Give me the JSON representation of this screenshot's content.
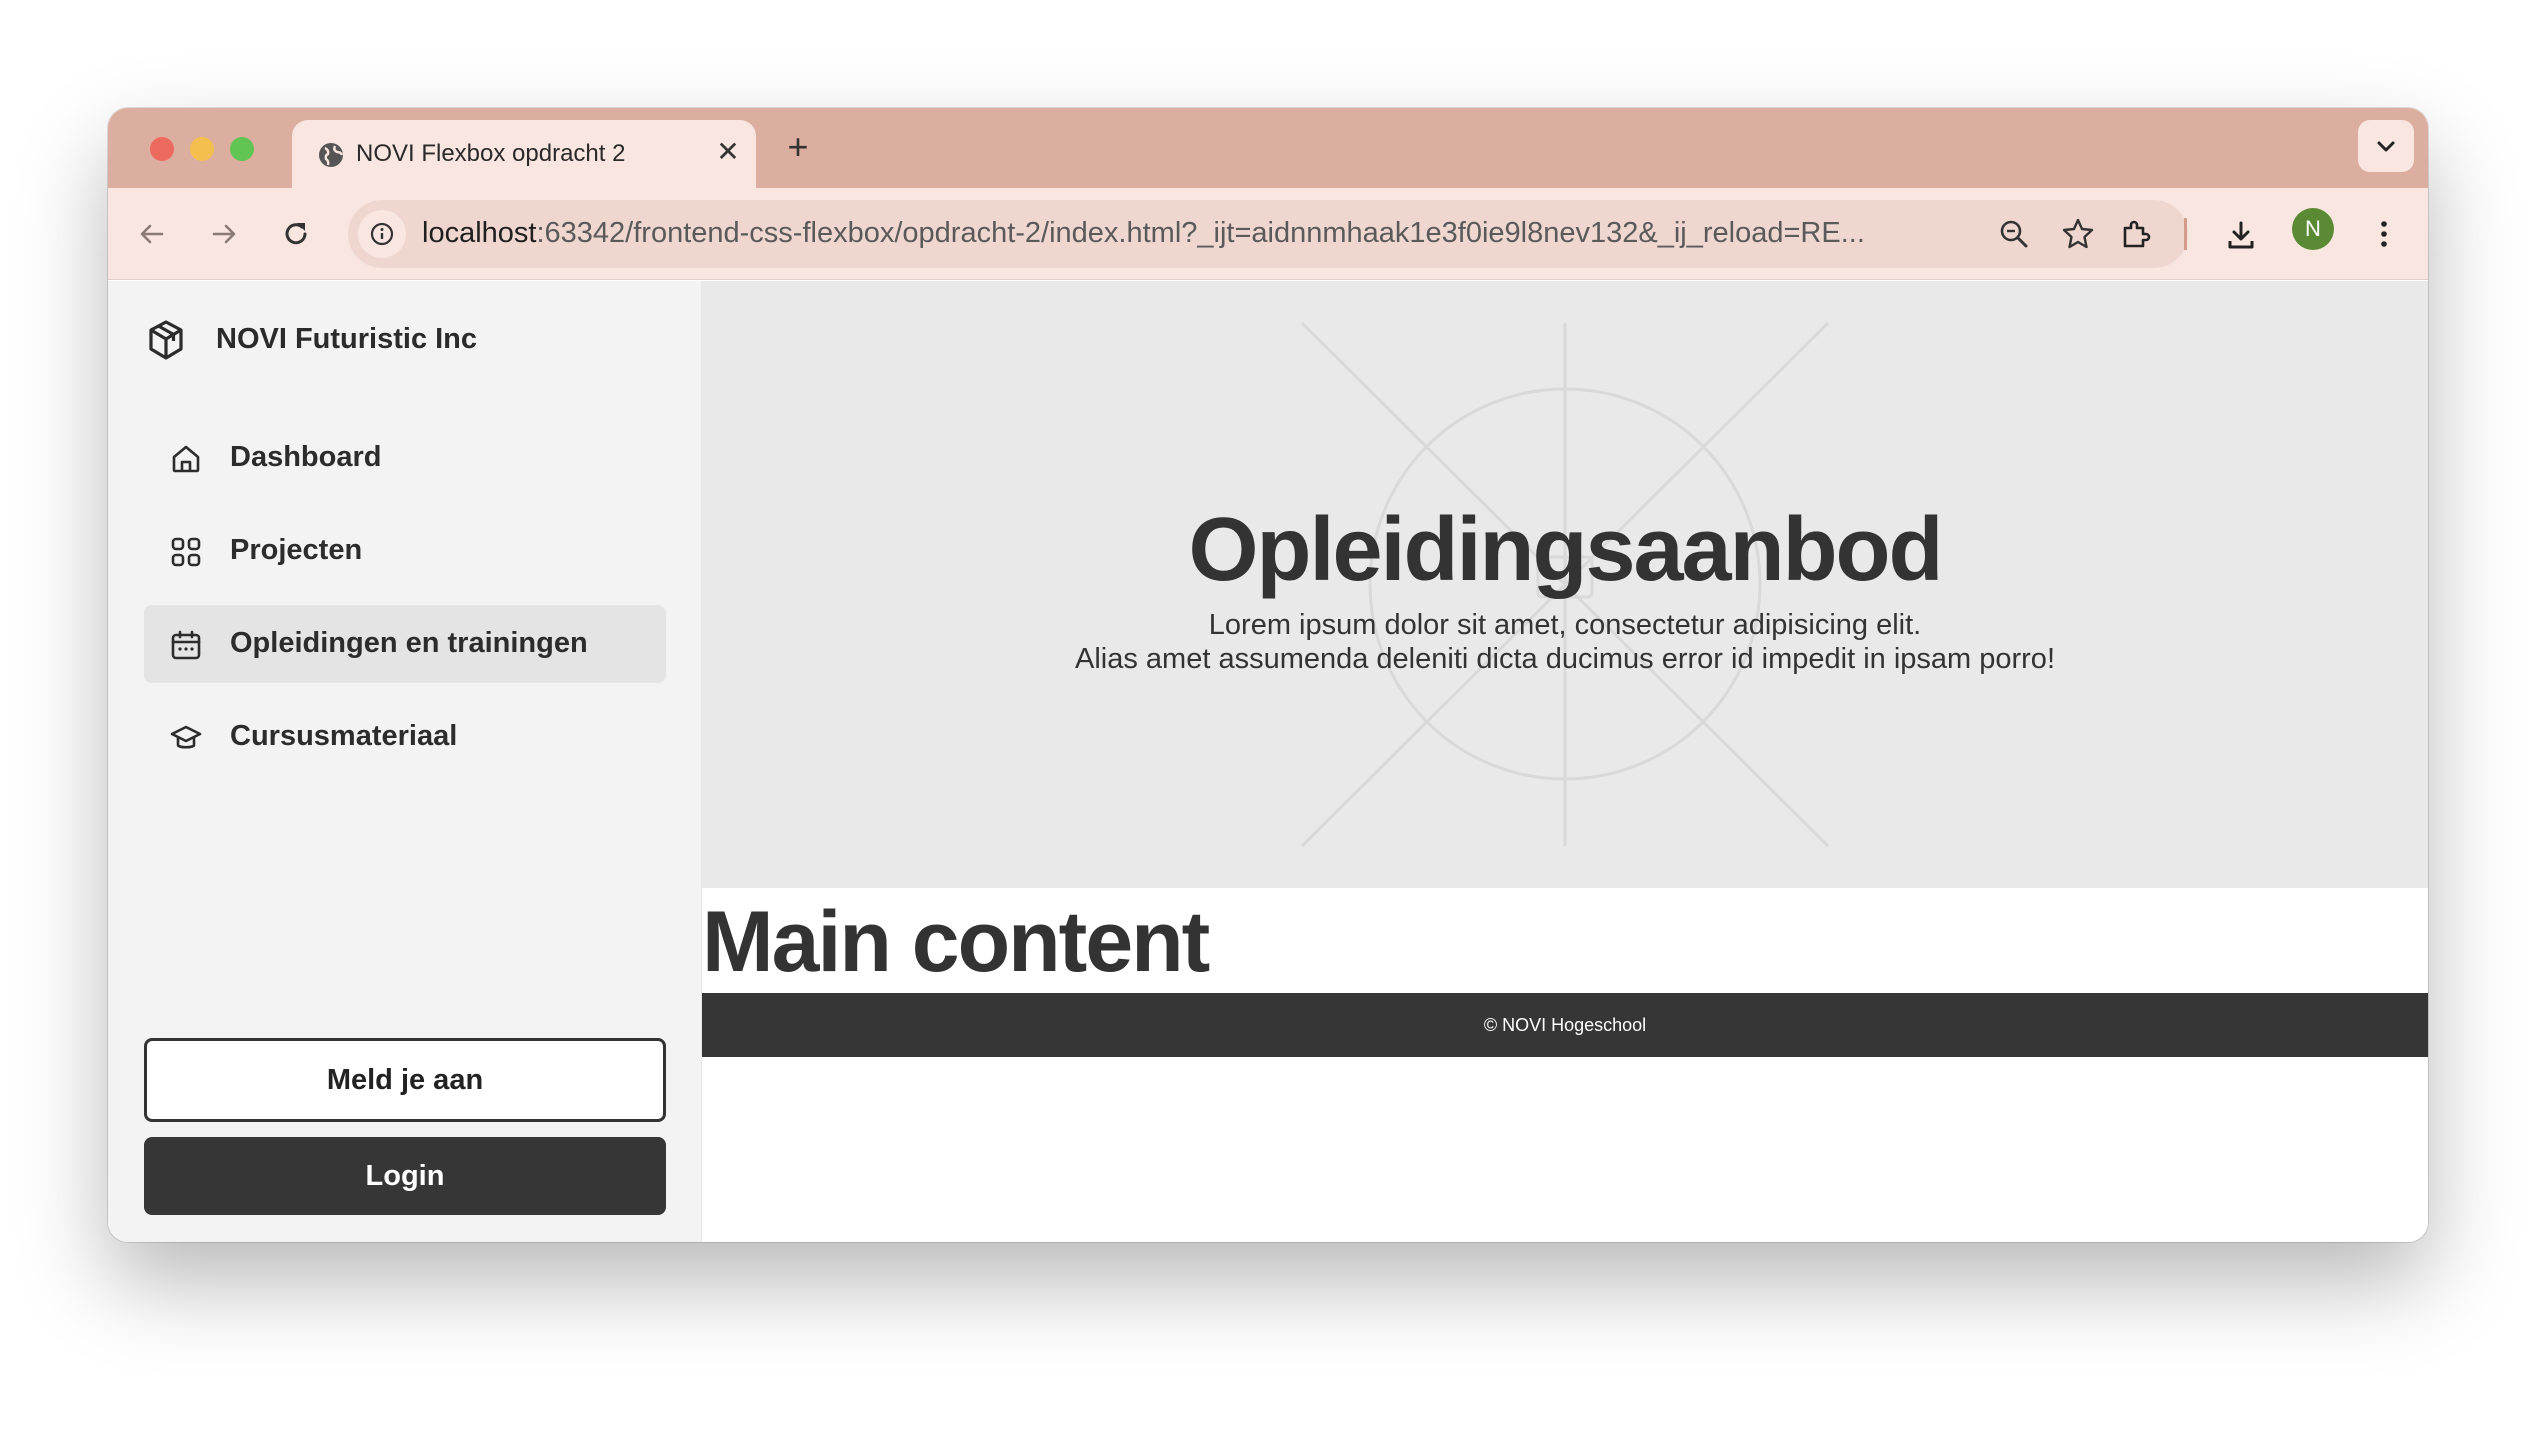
{
  "browser": {
    "tab_title": "NOVI Flexbox opdracht 2",
    "tab_close": "✕",
    "new_tab": "+",
    "url_host": "localhost",
    "url_rest": ":63342/frontend-css-flexbox/opdracht-2/index.html?_ijt=aidnnmhaak1e3f0ie9l8nev132&_ij_reload=RE...",
    "profile_initial": "N"
  },
  "sidebar": {
    "brand": "NOVI Futuristic Inc",
    "items": [
      {
        "label": "Dashboard",
        "icon": "home-icon",
        "active": false
      },
      {
        "label": "Projecten",
        "icon": "grid-icon",
        "active": false
      },
      {
        "label": "Opleidingen en trainingen",
        "icon": "calendar-icon",
        "active": true
      },
      {
        "label": "Cursusmateriaal",
        "icon": "graduation-cap-icon",
        "active": false
      }
    ],
    "register_label": "Meld je aan",
    "login_label": "Login"
  },
  "hero": {
    "title": "Opleidingsaanbod",
    "subtitle_line1": "Lorem ipsum dolor sit amet, consectetur adipisicing elit.",
    "subtitle_line2": "Alias amet assumenda deleniti dicta ducimus error id impedit in ipsam porro!"
  },
  "main": {
    "heading": "Main content"
  },
  "footer": {
    "text": "© NOVI Hogeschool"
  },
  "colors": {
    "tabstrip": "#dcaea0",
    "toolbar": "#f9e6e0",
    "dark": "#363636",
    "sidebar_bg": "#f3f3f3",
    "hero_bg": "#e9e9e9"
  }
}
